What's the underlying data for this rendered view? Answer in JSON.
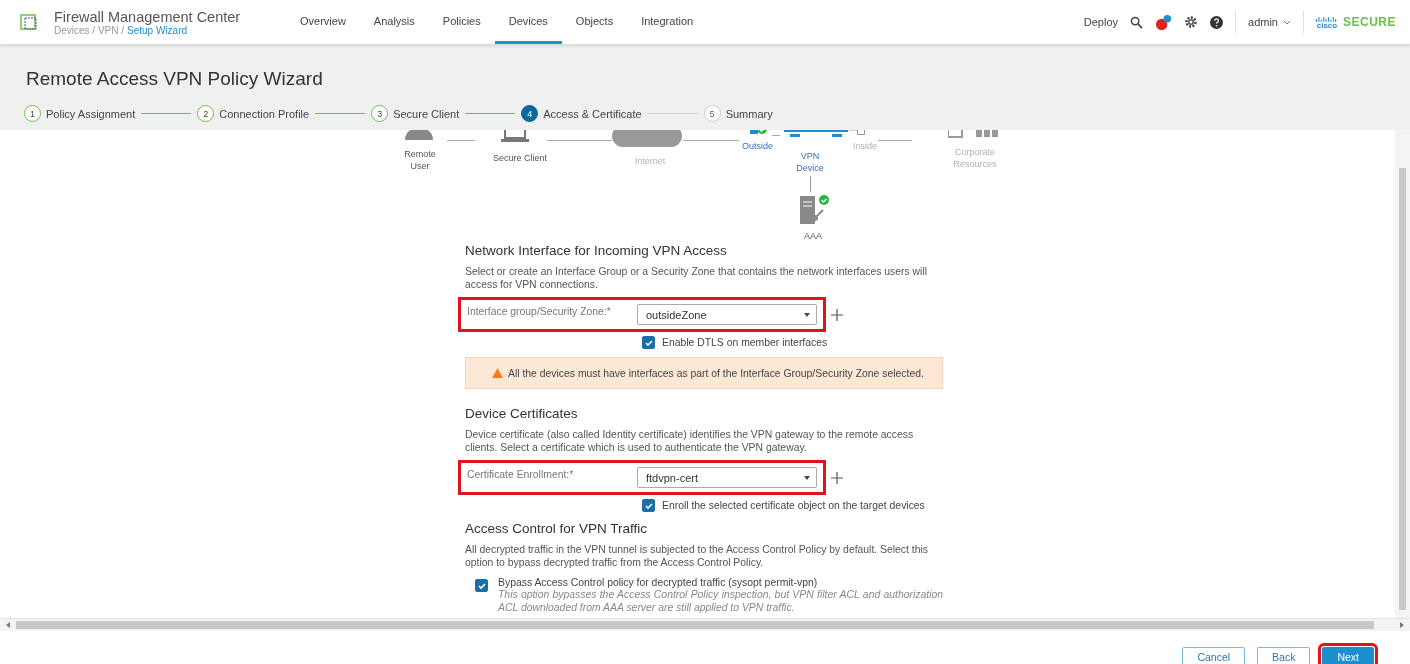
{
  "header": {
    "product": "Firewall Management Center",
    "breadcrumb_path": "Devices / VPN /",
    "breadcrumb_current": "Setup Wizard",
    "deploy": "Deploy",
    "user": "admin",
    "brand_mark": "cisco",
    "brand": "SECURE"
  },
  "nav": [
    {
      "label": "Overview",
      "selected": false
    },
    {
      "label": "Analysis",
      "selected": false
    },
    {
      "label": "Policies",
      "selected": false
    },
    {
      "label": "Devices",
      "selected": true
    },
    {
      "label": "Objects",
      "selected": false
    },
    {
      "label": "Integration",
      "selected": false
    }
  ],
  "page_title": "Remote Access VPN Policy Wizard",
  "steps": [
    {
      "number": "1",
      "label": "Policy Assignment",
      "done": true,
      "selected": false
    },
    {
      "number": "2",
      "label": "Connection Profile",
      "done": true,
      "selected": false
    },
    {
      "number": "3",
      "label": "Secure Client",
      "done": true,
      "selected": false
    },
    {
      "number": "4",
      "label": "Access & Certificate",
      "done": false,
      "selected": true
    },
    {
      "number": "5",
      "label": "Summary",
      "done": false,
      "selected": false
    }
  ],
  "diagram": {
    "labels": [
      {
        "text": "Remote\nUser",
        "active": false,
        "dimmed": false
      },
      {
        "text": "Secure Client",
        "active": false,
        "dimmed": false
      },
      {
        "text": "Internet",
        "active": false,
        "dimmed": true
      },
      {
        "text": "Outside",
        "active": true,
        "dimmed": false
      },
      {
        "text": "VPN\nDevice",
        "active": true,
        "dimmed": false
      },
      {
        "text": "Inside",
        "active": false,
        "dimmed": true
      },
      {
        "text": "Corporate\nResources",
        "active": false,
        "dimmed": true
      },
      {
        "text": "AAA",
        "active": false,
        "dimmed": false
      }
    ]
  },
  "sections": [
    {
      "heading": "Network Interface for Incoming VPN Access",
      "description": "Select or create an Interface Group or a Security Zone that contains the network interfaces users will access for VPN connections.",
      "field": {
        "label": "Interface group/Security Zone:*",
        "value": "outsideZone",
        "highlighted": true
      },
      "option": {
        "label": "Enable DTLS on member interfaces",
        "checked": true
      },
      "warning": "All the devices must have interfaces as part of the Interface Group/Security Zone selected."
    },
    {
      "heading": "Device Certificates",
      "description": "Device certificate (also called Identity certificate) identifies the VPN gateway to the remote access clients. Select a certificate which is used to authenticate the VPN gateway.",
      "field": {
        "label": "Certificate Enrollment:*",
        "value": "ftdvpn-cert",
        "highlighted": true
      },
      "option": {
        "label": "Enroll the selected certificate object on the target devices",
        "checked": true
      }
    },
    {
      "heading": "Access Control for VPN Traffic",
      "description": "All decrypted traffic in the VPN tunnel is subjected to the Access Control Policy by default. Select this option to bypass decrypted traffic from the Access Control Policy.",
      "bypass": {
        "label": "Bypass Access Control policy for decrypted traffic (sysopt permit-vpn)",
        "checked": true,
        "note": "This option bypasses the Access Control Policy inspection, but VPN filter ACL and authorization ACL downloaded from AAA server are still applied to VPN traffic."
      }
    }
  ],
  "buttons": [
    {
      "label": "Cancel",
      "kind": "secondary",
      "highlighted": false
    },
    {
      "label": "Back",
      "kind": "secondary",
      "highlighted": false
    },
    {
      "label": "Next",
      "kind": "primary",
      "highlighted": true
    }
  ]
}
